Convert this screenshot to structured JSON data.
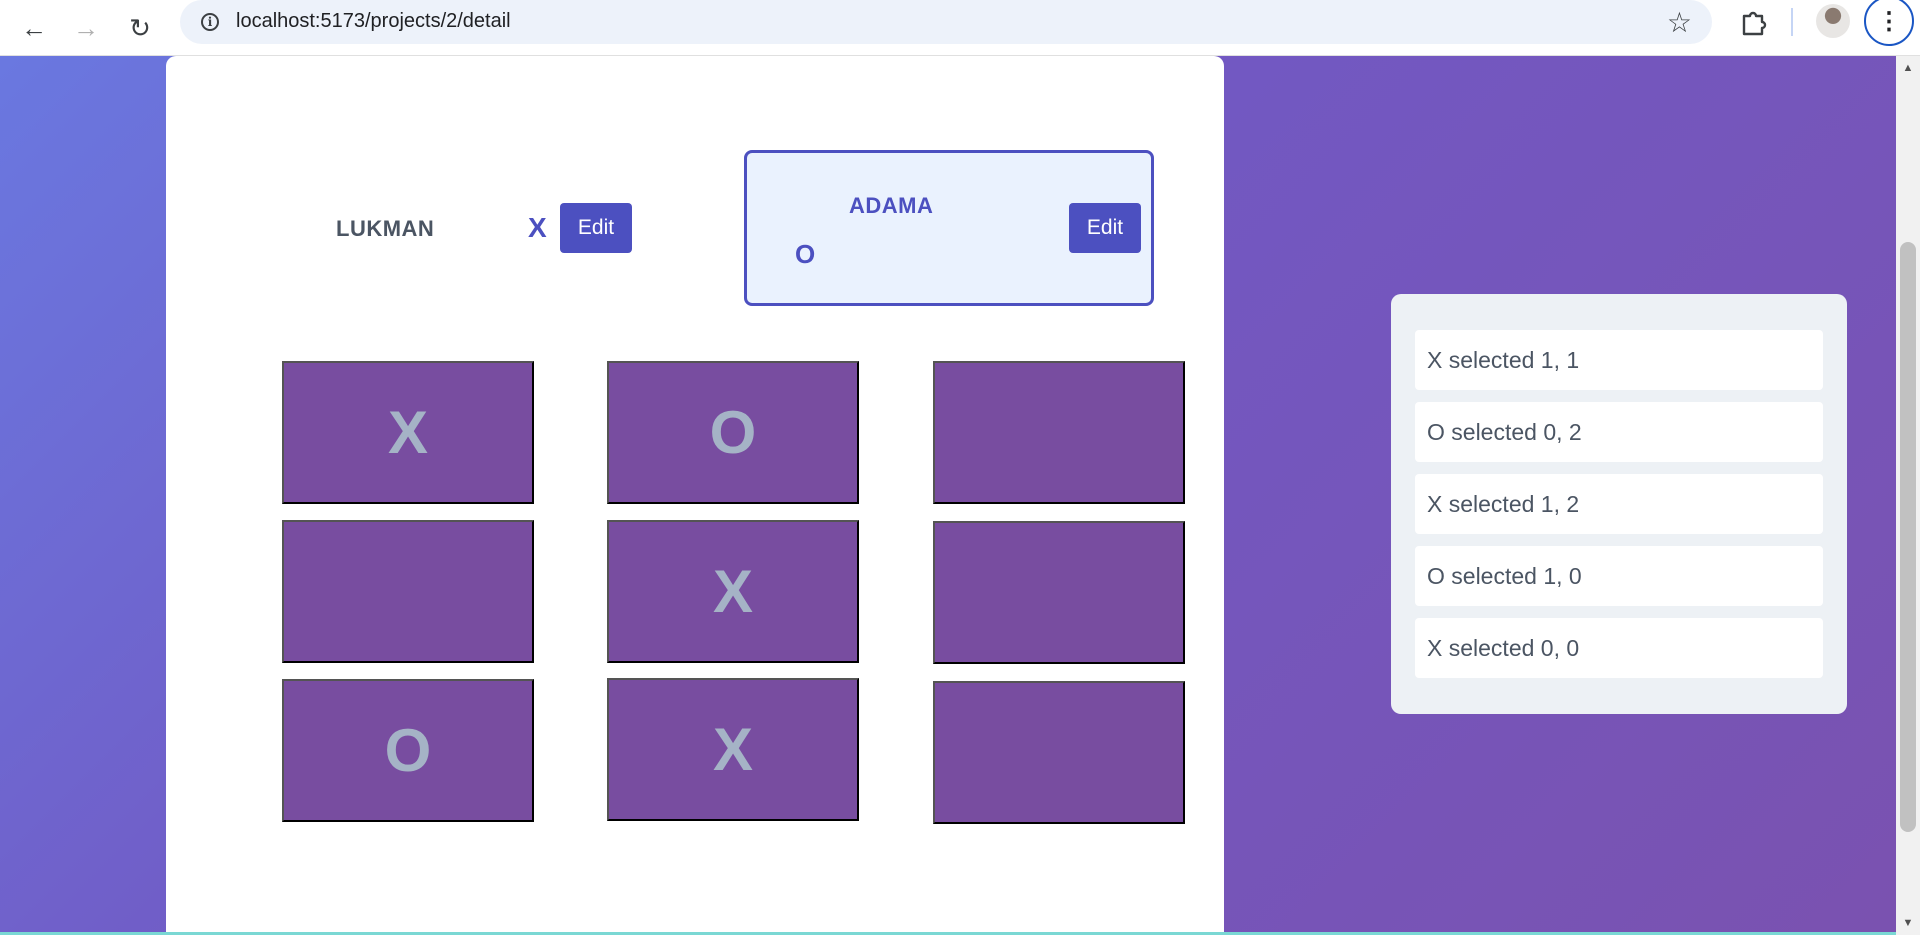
{
  "browser": {
    "url": "localhost:5173/projects/2/detail",
    "back_icon": "←",
    "forward_icon": "→",
    "reload_icon": "↻",
    "info_icon": "i",
    "star_icon": "☆",
    "menu_icon": "⋮"
  },
  "players": [
    {
      "name": "LUKMAN",
      "symbol": "X",
      "edit_label": "Edit",
      "active": false
    },
    {
      "name": "ADAMA",
      "symbol": "O",
      "edit_label": "Edit",
      "active": true
    }
  ],
  "board": [
    [
      "X",
      "O",
      ""
    ],
    [
      "",
      "X",
      ""
    ],
    [
      "O",
      "X",
      ""
    ]
  ],
  "log": [
    "X selected 1, 1",
    "O selected 0, 2",
    "X selected 1, 2",
    "O selected 1, 0",
    "X selected 0, 0"
  ],
  "colors": {
    "accent": "#4c50c0",
    "cell": "#784da0",
    "cell_text": "#a5b3c6",
    "background_start": "#6a78e0",
    "background_end": "#7a52b0"
  }
}
